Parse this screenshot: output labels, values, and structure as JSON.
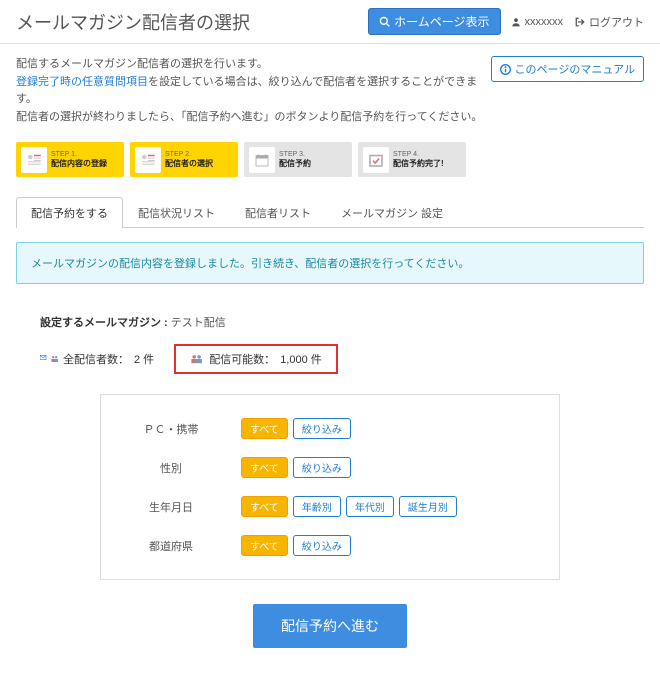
{
  "header": {
    "title": "メールマガジン配信者の選択",
    "homepage_btn": "ホームページ表示",
    "username": "xxxxxxx",
    "logout": "ログアウト"
  },
  "manual_btn": "このページのマニュアル",
  "description": {
    "line1": "配信するメールマガジン配信者の選択を行います。",
    "line2a": "登録完了時の任意質問項目",
    "line2b": "を設定している場合は、絞り込んで配信者を選択することができます。",
    "line3": "配信者の選択が終わりましたら、「配信予約へ進む」のボタンより配信予約を行ってください。"
  },
  "steps": [
    {
      "label": "STEP 1.",
      "title": "配信内容の登録"
    },
    {
      "label": "STEP 2.",
      "title": "配信者の選択"
    },
    {
      "label": "STEP 3.",
      "title": "配信予約"
    },
    {
      "label": "STEP 4.",
      "title": "配信予約完了!"
    }
  ],
  "tabs": [
    "配信予約をする",
    "配信状況リスト",
    "配信者リスト",
    "メールマガジン 設定"
  ],
  "alert": "メールマガジンの配信内容を登録しました。引き続き、配信者の選択を行ってください。",
  "mailmag": {
    "label": "設定するメールマガジン",
    "value": "テスト配信"
  },
  "counts": {
    "total_label": "全配信者数：",
    "total_value": "2 件",
    "capacity_label": "配信可能数：",
    "capacity_value": "1,000 件"
  },
  "filters": {
    "all": "すべて",
    "narrow": "絞り込み",
    "rows": [
      {
        "label": "ＰＣ・携帯",
        "chips": [
          "all",
          "narrow"
        ]
      },
      {
        "label": "性別",
        "chips": [
          "all",
          "narrow"
        ]
      },
      {
        "label": "生年月日",
        "chips": [
          "all",
          "byage",
          "byera",
          "bymonth"
        ]
      },
      {
        "label": "都道府県",
        "chips": [
          "all",
          "narrow"
        ]
      }
    ],
    "byage": "年齢別",
    "byera": "年代別",
    "bymonth": "誕生月別"
  },
  "proceed_btn": "配信予約へ進む"
}
